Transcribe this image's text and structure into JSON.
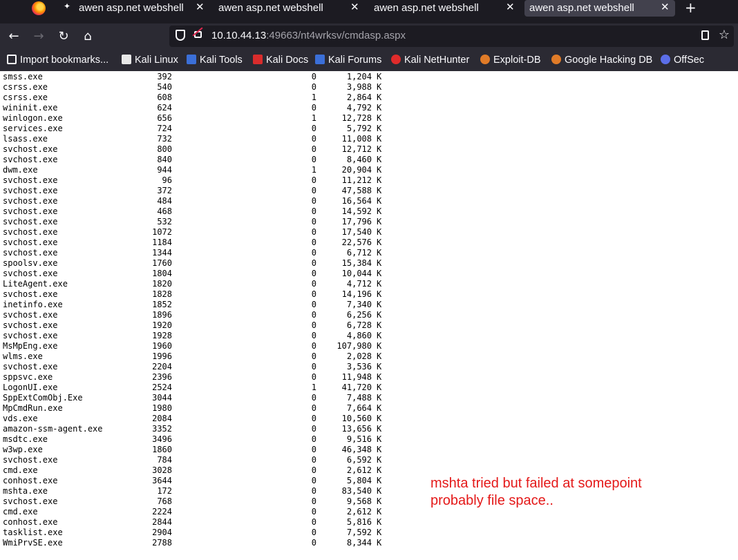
{
  "browser": {
    "tabs": [
      {
        "title": "awen asp.net webshell",
        "active": false
      },
      {
        "title": "awen asp.net webshell",
        "active": false
      },
      {
        "title": "awen asp.net webshell",
        "active": false
      },
      {
        "title": "awen asp.net webshell",
        "active": true
      }
    ],
    "url": {
      "host": "10.10.44.13",
      "rest": ":49663/nt4wrksv/cmdasp.aspx"
    },
    "bookmarks": [
      {
        "label": "Import bookmarks...",
        "icon": "import-icon",
        "color": "#fbfbfe"
      },
      {
        "label": "Kali Linux",
        "icon": "kali-dragon-icon",
        "color": "#e8e8e8"
      },
      {
        "label": "Kali Tools",
        "icon": "kali-tools-icon",
        "color": "#3b6fd8"
      },
      {
        "label": "Kali Docs",
        "icon": "kali-docs-icon",
        "color": "#d92c2c"
      },
      {
        "label": "Kali Forums",
        "icon": "kali-forums-icon",
        "color": "#3b6fd8"
      },
      {
        "label": "Kali NetHunter",
        "icon": "nethunter-icon",
        "color": "#e02b2b"
      },
      {
        "label": "Exploit-DB",
        "icon": "exploitdb-icon",
        "color": "#e07b28"
      },
      {
        "label": "Google Hacking DB",
        "icon": "ghdb-icon",
        "color": "#e07b28"
      },
      {
        "label": "OffSec",
        "icon": "offsec-icon",
        "color": "#5b6ee8"
      }
    ]
  },
  "tasklist": [
    {
      "name": "smss.exe",
      "pid": "392",
      "session": "0",
      "mem": "1,204",
      "unit": "K"
    },
    {
      "name": "csrss.exe",
      "pid": "540",
      "session": "0",
      "mem": "3,988",
      "unit": "K"
    },
    {
      "name": "csrss.exe",
      "pid": "608",
      "session": "1",
      "mem": "2,864",
      "unit": "K"
    },
    {
      "name": "wininit.exe",
      "pid": "624",
      "session": "0",
      "mem": "4,792",
      "unit": "K"
    },
    {
      "name": "winlogon.exe",
      "pid": "656",
      "session": "1",
      "mem": "12,728",
      "unit": "K"
    },
    {
      "name": "services.exe",
      "pid": "724",
      "session": "0",
      "mem": "5,792",
      "unit": "K"
    },
    {
      "name": "lsass.exe",
      "pid": "732",
      "session": "0",
      "mem": "11,008",
      "unit": "K"
    },
    {
      "name": "svchost.exe",
      "pid": "800",
      "session": "0",
      "mem": "12,712",
      "unit": "K"
    },
    {
      "name": "svchost.exe",
      "pid": "840",
      "session": "0",
      "mem": "8,460",
      "unit": "K"
    },
    {
      "name": "dwm.exe",
      "pid": "944",
      "session": "1",
      "mem": "20,904",
      "unit": "K"
    },
    {
      "name": "svchost.exe",
      "pid": "96",
      "session": "0",
      "mem": "11,212",
      "unit": "K"
    },
    {
      "name": "svchost.exe",
      "pid": "372",
      "session": "0",
      "mem": "47,588",
      "unit": "K"
    },
    {
      "name": "svchost.exe",
      "pid": "484",
      "session": "0",
      "mem": "16,564",
      "unit": "K"
    },
    {
      "name": "svchost.exe",
      "pid": "468",
      "session": "0",
      "mem": "14,592",
      "unit": "K"
    },
    {
      "name": "svchost.exe",
      "pid": "532",
      "session": "0",
      "mem": "17,796",
      "unit": "K"
    },
    {
      "name": "svchost.exe",
      "pid": "1072",
      "session": "0",
      "mem": "17,540",
      "unit": "K"
    },
    {
      "name": "svchost.exe",
      "pid": "1184",
      "session": "0",
      "mem": "22,576",
      "unit": "K"
    },
    {
      "name": "svchost.exe",
      "pid": "1344",
      "session": "0",
      "mem": "6,712",
      "unit": "K"
    },
    {
      "name": "spoolsv.exe",
      "pid": "1760",
      "session": "0",
      "mem": "15,384",
      "unit": "K"
    },
    {
      "name": "svchost.exe",
      "pid": "1804",
      "session": "0",
      "mem": "10,044",
      "unit": "K"
    },
    {
      "name": "LiteAgent.exe",
      "pid": "1820",
      "session": "0",
      "mem": "4,712",
      "unit": "K"
    },
    {
      "name": "svchost.exe",
      "pid": "1828",
      "session": "0",
      "mem": "14,196",
      "unit": "K"
    },
    {
      "name": "inetinfo.exe",
      "pid": "1852",
      "session": "0",
      "mem": "7,340",
      "unit": "K"
    },
    {
      "name": "svchost.exe",
      "pid": "1896",
      "session": "0",
      "mem": "6,256",
      "unit": "K"
    },
    {
      "name": "svchost.exe",
      "pid": "1920",
      "session": "0",
      "mem": "6,728",
      "unit": "K"
    },
    {
      "name": "svchost.exe",
      "pid": "1928",
      "session": "0",
      "mem": "4,860",
      "unit": "K"
    },
    {
      "name": "MsMpEng.exe",
      "pid": "1960",
      "session": "0",
      "mem": "107,980",
      "unit": "K"
    },
    {
      "name": "wlms.exe",
      "pid": "1996",
      "session": "0",
      "mem": "2,028",
      "unit": "K"
    },
    {
      "name": "svchost.exe",
      "pid": "2204",
      "session": "0",
      "mem": "3,536",
      "unit": "K"
    },
    {
      "name": "sppsvc.exe",
      "pid": "2396",
      "session": "0",
      "mem": "11,948",
      "unit": "K"
    },
    {
      "name": "LogonUI.exe",
      "pid": "2524",
      "session": "1",
      "mem": "41,720",
      "unit": "K"
    },
    {
      "name": "SppExtComObj.Exe",
      "pid": "3044",
      "session": "0",
      "mem": "7,488",
      "unit": "K"
    },
    {
      "name": "MpCmdRun.exe",
      "pid": "1980",
      "session": "0",
      "mem": "7,664",
      "unit": "K"
    },
    {
      "name": "vds.exe",
      "pid": "2084",
      "session": "0",
      "mem": "10,560",
      "unit": "K"
    },
    {
      "name": "amazon-ssm-agent.exe",
      "pid": "3352",
      "session": "0",
      "mem": "13,656",
      "unit": "K"
    },
    {
      "name": "msdtc.exe",
      "pid": "3496",
      "session": "0",
      "mem": "9,516",
      "unit": "K"
    },
    {
      "name": "w3wp.exe",
      "pid": "1860",
      "session": "0",
      "mem": "46,348",
      "unit": "K"
    },
    {
      "name": "svchost.exe",
      "pid": "784",
      "session": "0",
      "mem": "6,592",
      "unit": "K"
    },
    {
      "name": "cmd.exe",
      "pid": "3028",
      "session": "0",
      "mem": "2,612",
      "unit": "K"
    },
    {
      "name": "conhost.exe",
      "pid": "3644",
      "session": "0",
      "mem": "5,804",
      "unit": "K"
    },
    {
      "name": "mshta.exe",
      "pid": "172",
      "session": "0",
      "mem": "83,540",
      "unit": "K"
    },
    {
      "name": "svchost.exe",
      "pid": "768",
      "session": "0",
      "mem": "9,568",
      "unit": "K"
    },
    {
      "name": "cmd.exe",
      "pid": "2224",
      "session": "0",
      "mem": "2,612",
      "unit": "K"
    },
    {
      "name": "conhost.exe",
      "pid": "2844",
      "session": "0",
      "mem": "5,816",
      "unit": "K"
    },
    {
      "name": "tasklist.exe",
      "pid": "2904",
      "session": "0",
      "mem": "7,592",
      "unit": "K"
    },
    {
      "name": "WmiPrvSE.exe",
      "pid": "2788",
      "session": "0",
      "mem": "8,344",
      "unit": "K"
    }
  ],
  "annotation": {
    "line1": "mshta tried but failed at somepoint",
    "line2": "probably file space..",
    "color": "#e41818"
  }
}
